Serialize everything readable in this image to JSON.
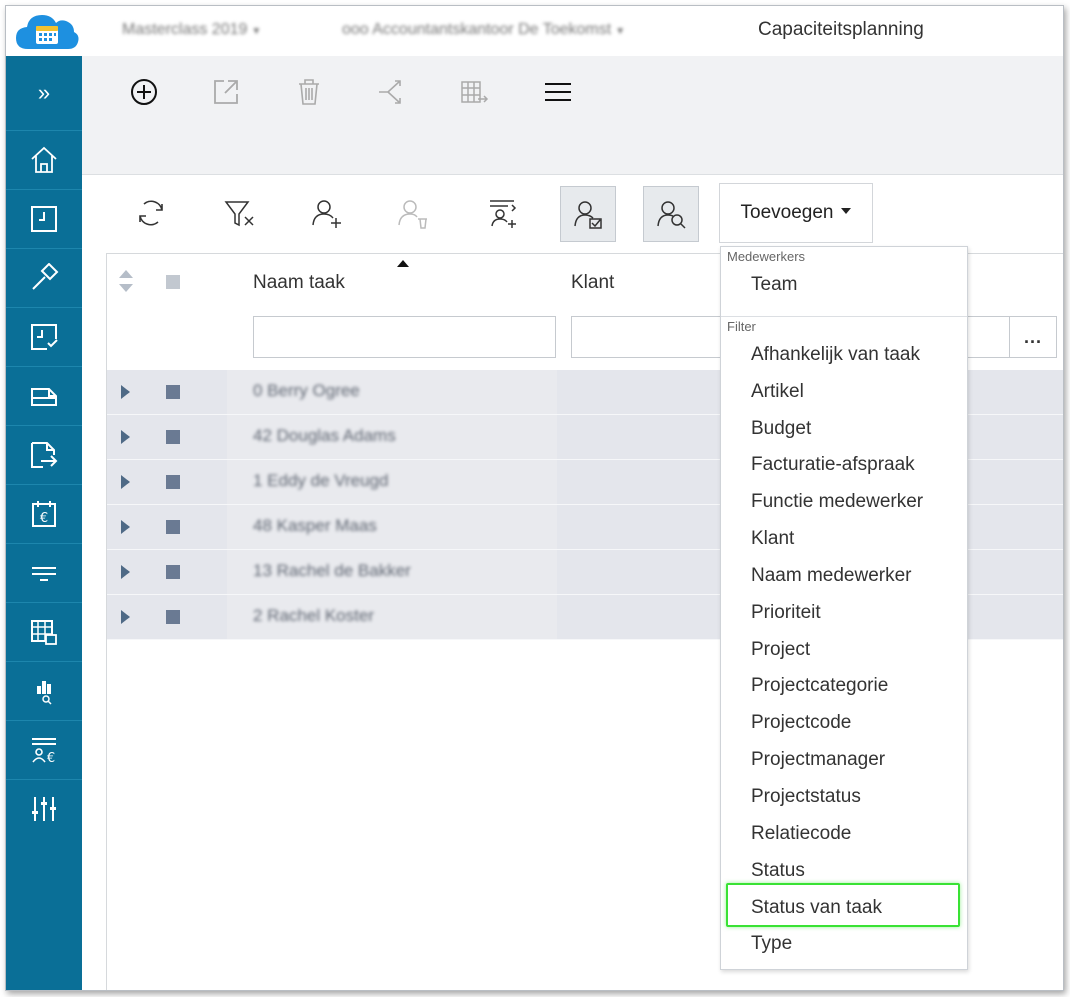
{
  "topbar": {
    "crumb1": "Masterclass 2019",
    "crumb2": "ooo Accountantskantoor De Toekomst",
    "title": "Capaciteitsplanning"
  },
  "sidebar": {
    "expand_label": "»",
    "items": [
      {
        "icon": "home-icon"
      },
      {
        "icon": "hours-icon"
      },
      {
        "icon": "hammer-icon"
      },
      {
        "icon": "approve-hours-icon"
      },
      {
        "icon": "invoice-icon"
      },
      {
        "icon": "send-invoice-icon"
      },
      {
        "icon": "calendar-euro-icon"
      },
      {
        "icon": "filter-lines-icon"
      },
      {
        "icon": "planning-calendar-icon"
      },
      {
        "icon": "reports-search-icon"
      },
      {
        "icon": "employee-euro-icon"
      },
      {
        "icon": "settings-sliders-icon"
      }
    ]
  },
  "toolbar1": {
    "buttons": [
      "add-icon",
      "open-external-icon",
      "delete-icon",
      "merge-icon",
      "schedule-icon",
      "hamburger-menu-icon"
    ]
  },
  "toolbar2": {
    "buttons": [
      "refresh-icon",
      "clear-filter-icon",
      "add-employee-icon",
      "remove-employee-icon",
      "add-task-icon",
      "assign-employee-icon",
      "search-employee-icon"
    ],
    "add_dropdown_label": "Toevoegen"
  },
  "grid": {
    "columns": [
      {
        "label": "Naam taak"
      },
      {
        "label": "Klant"
      }
    ],
    "more_label": "...",
    "rows": [
      {
        "name": "0 Berry Ogree"
      },
      {
        "name": "42 Douglas Adams"
      },
      {
        "name": "1 Eddy de Vreugd"
      },
      {
        "name": "48 Kasper Maas"
      },
      {
        "name": "13 Rachel de Bakker"
      },
      {
        "name": "2 Rachel Koster"
      }
    ]
  },
  "menu": {
    "group1_label": "Medewerkers",
    "group1_items": [
      "Team"
    ],
    "group2_label": "Filter",
    "group2_items": [
      "Afhankelijk van taak",
      "Artikel",
      "Budget",
      "Facturatie-afspraak",
      "Functie medewerker",
      "Klant",
      "Naam medewerker",
      "Prioriteit",
      "Project",
      "Projectcategorie",
      "Projectcode",
      "Projectmanager",
      "Projectstatus",
      "Relatiecode",
      "Status",
      "Status van taak",
      "Type"
    ],
    "highlighted_item": "Status van taak",
    "highlight_color": "#39e234"
  },
  "colors": {
    "sidebar_bg": "#0a6f97",
    "toolbar_bg": "#f1f2f4",
    "row_bg": "#e4e6ec",
    "logo_blue": "#1e90e0"
  }
}
